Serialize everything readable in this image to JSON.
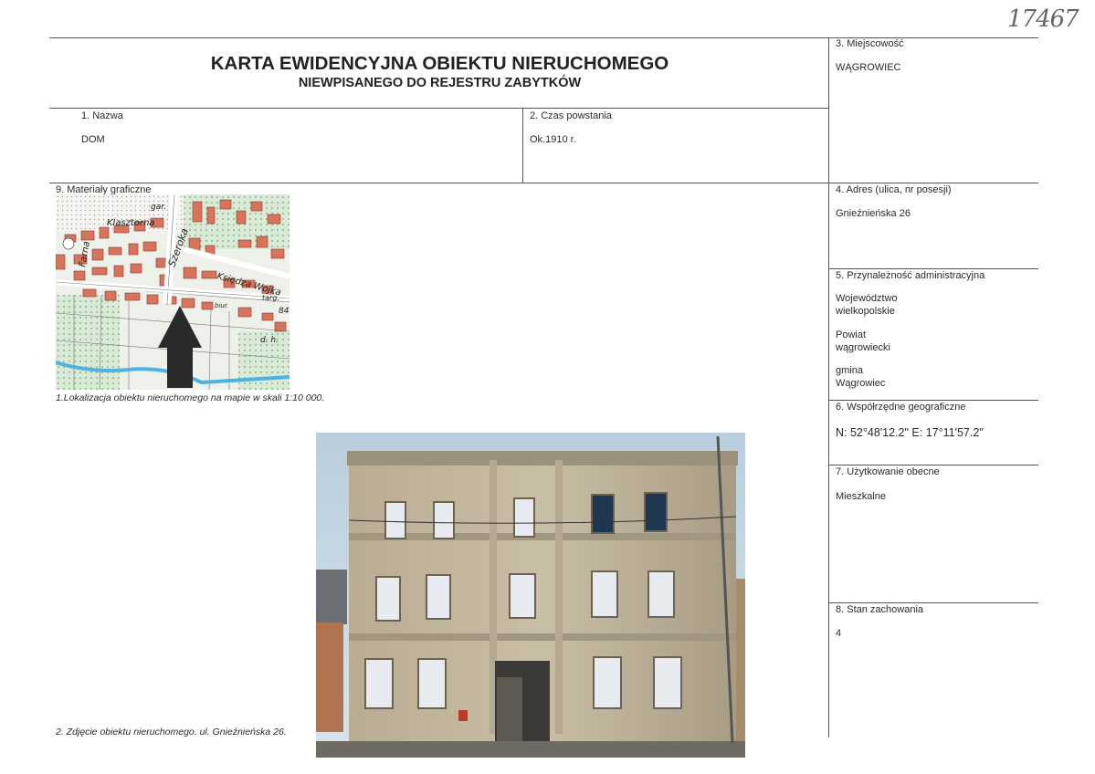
{
  "doc_number": "17467",
  "title_line1": "KARTA EWIDENCYJNA OBIEKTU NIERUCHOMEGO",
  "title_line2": "NIEWPISANEGO DO REJESTRU ZABYTKÓW",
  "field1": {
    "label": "1.    Nazwa",
    "value": "DOM"
  },
  "field2": {
    "label": "2. Czas powstania",
    "value": "Ok.1910 r."
  },
  "field3": {
    "label": "3. Miejscowość",
    "value": "WĄGROWIEC"
  },
  "field4": {
    "label": "4. Adres (ulica, nr posesji)",
    "value": "Gnieźnieńska 26"
  },
  "field5": {
    "label": "5. Przynależność administracyjna",
    "woj_a": "Województwo",
    "woj_b": "wielkopolskie",
    "pow_a": "Powiat",
    "pow_b": "wągrowiecki",
    "gm_a": "gmina",
    "gm_b": "Wągrowiec"
  },
  "field6": {
    "label": "6. Współrzędne geograficzne",
    "value": "N: 52°48'12.2\"  E: 17°11'57.2\""
  },
  "field7": {
    "label": "7. Użytkowanie obecne",
    "value": "Mieszkalne"
  },
  "field8": {
    "label": "8. Stan zachowania",
    "value": "4"
  },
  "field9": {
    "label": "9. Materiały graficzne"
  },
  "map": {
    "caption": "1.Lokalizacja obiektu nieruchomego na mapie w skali 1:10 000.",
    "labels": [
      "gar.",
      "Klasztorna",
      "Farna",
      "Szeroka",
      "Księdza Wojka",
      "targ.",
      "biur.",
      "84",
      "d. h."
    ]
  },
  "photo": {
    "caption": "2. Zdjęcie obiektu nieruchomego. ul. Gnieźnieńska 26."
  }
}
